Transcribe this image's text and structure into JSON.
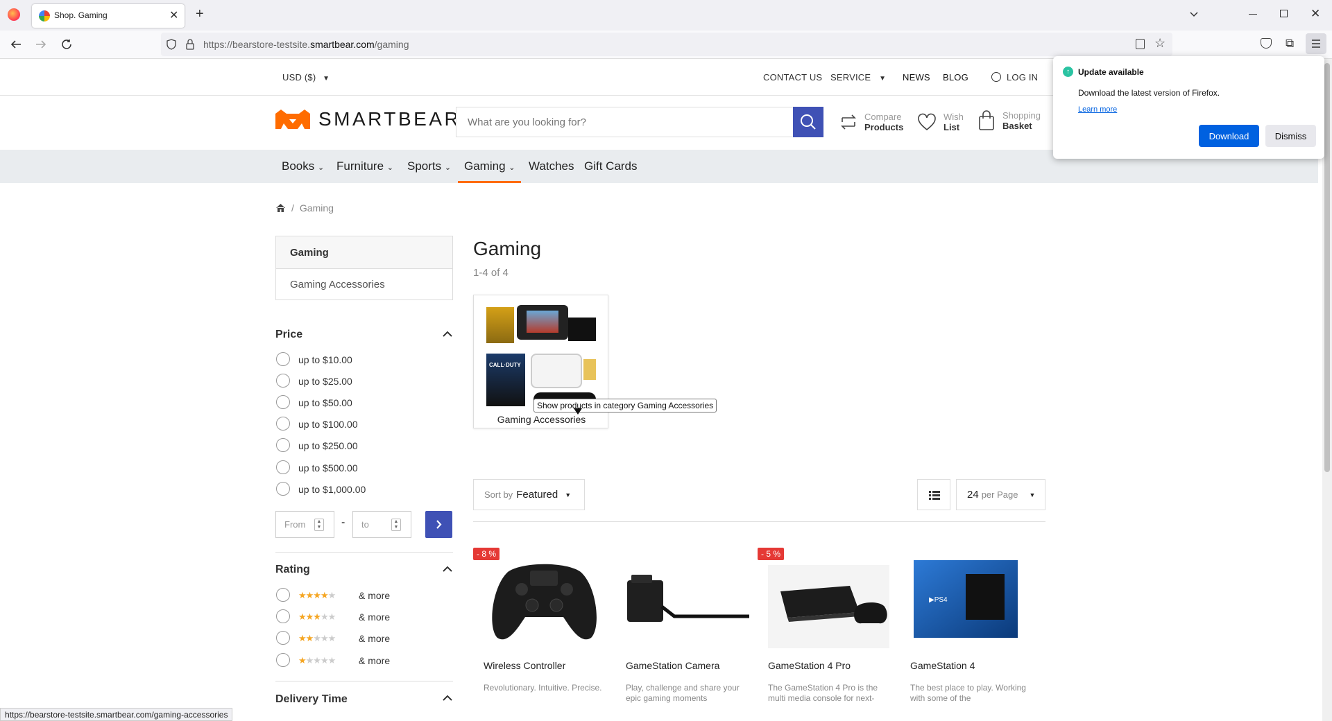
{
  "browser": {
    "tab_title": "Shop. Gaming",
    "url_host_prefix": "https://bearstore-testsite.",
    "url_host_main": "smartbear.com",
    "url_path": "/gaming",
    "status_url": "https://bearstore-testsite.smartbear.com/gaming-accessories"
  },
  "update_popup": {
    "title": "Update available",
    "text": "Download the latest version of Firefox.",
    "link": "Learn more",
    "download": "Download",
    "dismiss": "Dismiss"
  },
  "topbar": {
    "currency": "USD ($)",
    "contact": "CONTACT US",
    "service": "SERVICE",
    "news": "NEWS",
    "blog": "BLOG",
    "login": "LOG IN"
  },
  "header": {
    "logo_text": "SMARTBEAR",
    "search_placeholder": "What are you looking for?",
    "compare_top": "Compare",
    "compare_bottom": "Products",
    "wish_top": "Wish",
    "wish_bottom": "List",
    "basket_top": "Shopping",
    "basket_bottom": "Basket"
  },
  "main_nav": [
    "Books",
    "Furniture",
    "Sports",
    "Gaming",
    "Watches",
    "Gift Cards"
  ],
  "breadcrumb": {
    "current": "Gaming"
  },
  "sidebar": {
    "category_title": "Gaming",
    "subcategory": "Gaming Accessories",
    "price_title": "Price",
    "price_options": [
      "up to $10.00",
      "up to $25.00",
      "up to $50.00",
      "up to $100.00",
      "up to $250.00",
      "up to $500.00",
      "up to $1,000.00"
    ],
    "from_placeholder": "From",
    "to_placeholder": "to",
    "rating_title": "Rating",
    "rating_options": [
      {
        "stars": 4,
        "label": "& more"
      },
      {
        "stars": 3,
        "label": "& more"
      },
      {
        "stars": 2,
        "label": "& more"
      },
      {
        "stars": 1,
        "label": "& more"
      }
    ],
    "delivery_title": "Delivery Time"
  },
  "content": {
    "title": "Gaming",
    "count": "1-4 of 4",
    "category_card": "Gaming Accessories",
    "tooltip": "Show products in category Gaming Accessories",
    "sort_prefix": "Sort by",
    "sort_value": "Featured",
    "per_page_value": "24",
    "per_page_label": "per Page"
  },
  "products": [
    {
      "name": "Wireless Controller",
      "desc": "Revolutionary. Intuitive. Precise.",
      "badge": "- 8 %"
    },
    {
      "name": "GameStation Camera",
      "desc": "Play, challenge and share your epic gaming moments",
      "badge": ""
    },
    {
      "name": "GameStation 4 Pro",
      "desc": "The GameStation 4 Pro is the multi media console for next-",
      "badge": "- 5 %"
    },
    {
      "name": "GameStation 4",
      "desc": "The best place to play. Working with some of the",
      "badge": ""
    }
  ],
  "colors": {
    "accent": "#3f51b5",
    "logo_orange": "#ff6c00",
    "gaming_underline": "#ff6c00",
    "badge_red": "#e53935",
    "firefox_blue": "#0061e0"
  }
}
